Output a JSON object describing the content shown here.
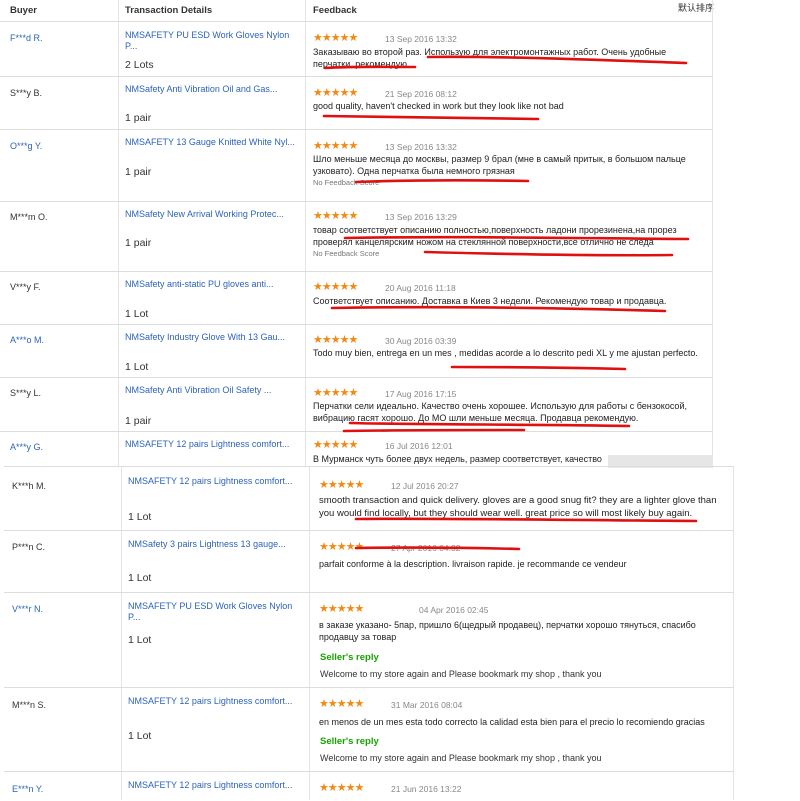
{
  "header": {
    "buyer": "Buyer",
    "transaction": "Transaction Details",
    "feedback": "Feedback",
    "sort": "默认排序"
  },
  "rows": [
    {
      "buyer": "F***d R.",
      "product": "NMSAFETY PU ESD Work Gloves Nylon P...",
      "qty": "2 Lots",
      "stars": "★★★★★",
      "date": "13 Sep 2016 13:32",
      "feedback": "Заказываю во второй раз. Использую для электромонтажных работ. Очень удобные перчатки, рекомендую."
    },
    {
      "buyer": "S***y B.",
      "product": "NMSafety Anti Vibration Oil and Gas...",
      "qty": "1 pair",
      "stars": "★★★★★",
      "date": "21 Sep 2016 08:12",
      "feedback": "good quality, haven't checked in work but they look like not bad"
    },
    {
      "buyer": "O***g Y.",
      "product": "NMSAFETY 13 Gauge Knitted White Nyl...",
      "qty": "1 pair",
      "stars": "★★★★★",
      "date": "13 Sep 2016 13:32",
      "feedback": "Шло меньше месяца до москвы, размер 9 брал (мне в самый притык, в большом пальце узковато). Одна перчатка была немного грязная",
      "no_feedback": "No Feedback Score"
    },
    {
      "buyer": "M***m O.",
      "product": "NMSafety New Arrival Working Protec...",
      "qty": "1 pair",
      "stars": "★★★★★",
      "date": "13 Sep 2016 13:29",
      "feedback": "товар соответствует описанию полностью,поверхность ладони прорезинена,на прорез проверял канцелярским ножом на стеклянной поверхности,всё отлично не следа",
      "no_feedback": "No Feedback Score"
    },
    {
      "buyer": "V***y F.",
      "product": "NMSafety anti-static PU gloves anti...",
      "qty": "1 Lot",
      "stars": "★★★★★",
      "date": "20 Aug 2016 11:18",
      "feedback": "Соответствует описанию. Доставка в Киев 3 недели. Рекомендую товар и продавца."
    },
    {
      "buyer": "A***o M.",
      "product": "NMSafety Industry Glove With 13 Gau...",
      "qty": "1 Lot",
      "stars": "★★★★★",
      "date": "30 Aug 2016 03:39",
      "feedback": "Todo muy bien, entrega en un mes , medidas acorde a lo descrito pedi XL y me ajustan perfecto."
    },
    {
      "buyer": "S***y L.",
      "product": "NMSafety Anti Vibration Oil Safety ...",
      "qty": "1 pair",
      "stars": "★★★★★",
      "date": "17 Aug 2016 17:15",
      "feedback": "Перчатки сели идеально. Качество очень хорошее. Использую для работы с бензокосой, вибрацию гасят хорошо. До МО шли меньше месяца. Продавца рекомендую."
    },
    {
      "buyer": "A***y G.",
      "product": "NMSAFETY 12 pairs Lightness comfort...",
      "qty": "",
      "stars": "★★★★★",
      "date": "16 Jul 2016 12:01",
      "feedback": "В Мурманск чуть более двух недель, размер соответствует, качество"
    },
    {
      "buyer": "K***h M.",
      "product": "NMSAFETY 12 pairs Lightness comfort...",
      "qty": "1 Lot",
      "stars": "★★★★★",
      "date": "12 Jul 2016 20:27",
      "feedback": "smooth transaction and quick delivery. gloves are a good snug fit? they are a lighter glove than you would find locally, but they should wear well. great price so will most likely buy again."
    },
    {
      "buyer": "P***n C.",
      "product": "NMSafety 3 pairs Lightness 13 gauge...",
      "qty": "1 Lot",
      "stars": "★★★★★",
      "date": "27 Apr 2016 04:32",
      "feedback": "parfait conforme à la description. livraison rapide. je recommande ce vendeur"
    },
    {
      "buyer": "V***r N.",
      "product": "NMSAFETY PU ESD Work Gloves Nylon P...",
      "qty": "1 Lot",
      "stars": "★★★★★",
      "date": "04 Apr 2016 02:45",
      "feedback": "в заказе указано- 5пар, пришло 6(щедрый продавец), перчатки хорошо тянуться, спасибо продавцу за товар",
      "reply_label": "Seller's reply",
      "reply": "Welcome to my store again and Please bookmark my shop , thank you"
    },
    {
      "buyer": "M***n S.",
      "product": "NMSAFETY 12 pairs Lightness comfort...",
      "qty": "1 Lot",
      "stars": "★★★★★",
      "date": "31 Mar 2016 08:04",
      "feedback": "en menos de un mes esta todo correcto la calidad esta bien para el precio lo recomiendo gracias",
      "reply_label": "Seller's reply",
      "reply": "Welcome to my store again and Please bookmark my shop , thank you"
    },
    {
      "buyer": "E***n Y.",
      "product": "NMSAFETY 12 pairs Lightness comfort...",
      "qty": "",
      "stars": "★★★★★",
      "date": "21 Jun 2016 13:22",
      "feedback": ""
    }
  ]
}
